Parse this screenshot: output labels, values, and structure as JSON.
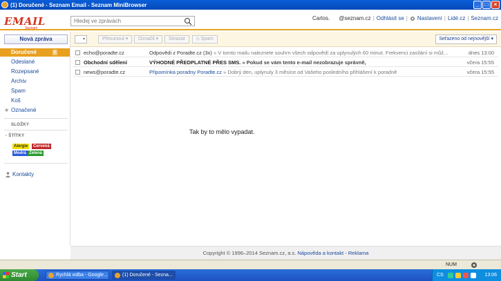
{
  "window": {
    "title": "(1) Doručené - Seznam Email - Seznam MiniBrowser",
    "min_label": "_",
    "max_label": "□",
    "close_label": "×"
  },
  "header": {
    "logo_main": "EMAIL",
    "logo_sub": "Seznam",
    "search_placeholder": "Hledej ve zprávách",
    "user_name": "Carlos.",
    "user_email": "@seznam.cz",
    "logout": "Odhlásit se",
    "settings": "Nastavení",
    "people": "Lidé.cz",
    "seznam": "Seznam.cz",
    "sep": "|"
  },
  "sidebar": {
    "new_message": "Nová zpráva",
    "folders": [
      {
        "label": "Doručené",
        "badge": "1",
        "active": true
      },
      {
        "label": "Odeslané"
      },
      {
        "label": "Rozepsané"
      },
      {
        "label": "Archiv"
      },
      {
        "label": "Spam"
      },
      {
        "label": "Koš"
      },
      {
        "label": "Označené"
      }
    ],
    "folders_heading": "SLOŽKY",
    "labels_heading": "ŠTÍTKY",
    "labels_toggle": "-",
    "tags": [
      {
        "label": "Alergie",
        "bg": "#f2e000",
        "fg": "#333"
      },
      {
        "label": "Červená",
        "bg": "#c0282a",
        "fg": "#ffffff"
      },
      {
        "label": "Modrá",
        "bg": "#2a5ad8",
        "fg": "#ffffff"
      },
      {
        "label": "Zelená",
        "bg": "#2a9a2a",
        "fg": "#ffffff"
      }
    ],
    "contacts": "Kontakty"
  },
  "toolbar": {
    "select_arrow": "▾",
    "move": "Přesunout ▾",
    "mark": "Označit ▾",
    "delete": "Smazat",
    "spam": "⦸ Spam",
    "sort": "Seřazeno od nejnovější ▾"
  },
  "messages": [
    {
      "from": "echo@poradte.cz",
      "subject": "Odpovědi z Poradte.cz (3x)",
      "preview": " » V tomto mailu naleznete souhrn všech odpovědí za uplynulých 60 minut. Frekvenci zasílání si můž...",
      "date": "dnes 13:00",
      "unread": false
    },
    {
      "from": "Obchodní sdělení",
      "subject": "VÝHODNÉ PŘEDPLATNÉ PŘES SMS.",
      "preview": " » Pokud se vám tento e-mail nezobrazuje správně,",
      "date": "včera 15:55",
      "unread": true
    },
    {
      "from": "news@poradte.cz",
      "subject": "Připomínka poradny Poradte.cz",
      "preview": " » Dobrý den, uplynuly 3 měsíce od Vašeho posledního přihlášení k poradně",
      "date": "včera 15:55",
      "unread": false
    }
  ],
  "main": {
    "message": "Tak by to mělo vypadat."
  },
  "footer": {
    "copyright": "Copyright © 1996–2014 Seznam.cz, a.s.",
    "help": "Nápověda a kontakt",
    "sep": " - ",
    "ads": "Reklama"
  },
  "statusbar": {
    "num": "NUM"
  },
  "taskbar": {
    "start": "Start",
    "tasks": [
      {
        "label": "Rychlá volba - Google...",
        "icon_color": "#e8a030"
      },
      {
        "label": "(1) Doručené - Sezna...",
        "icon_color": "#e8a030",
        "active": true
      }
    ],
    "lang": "CS",
    "clock": "13:06"
  },
  "colors": {
    "accent": "#e8a020",
    "link": "#1a4a9a",
    "brand": "#d4351c"
  }
}
